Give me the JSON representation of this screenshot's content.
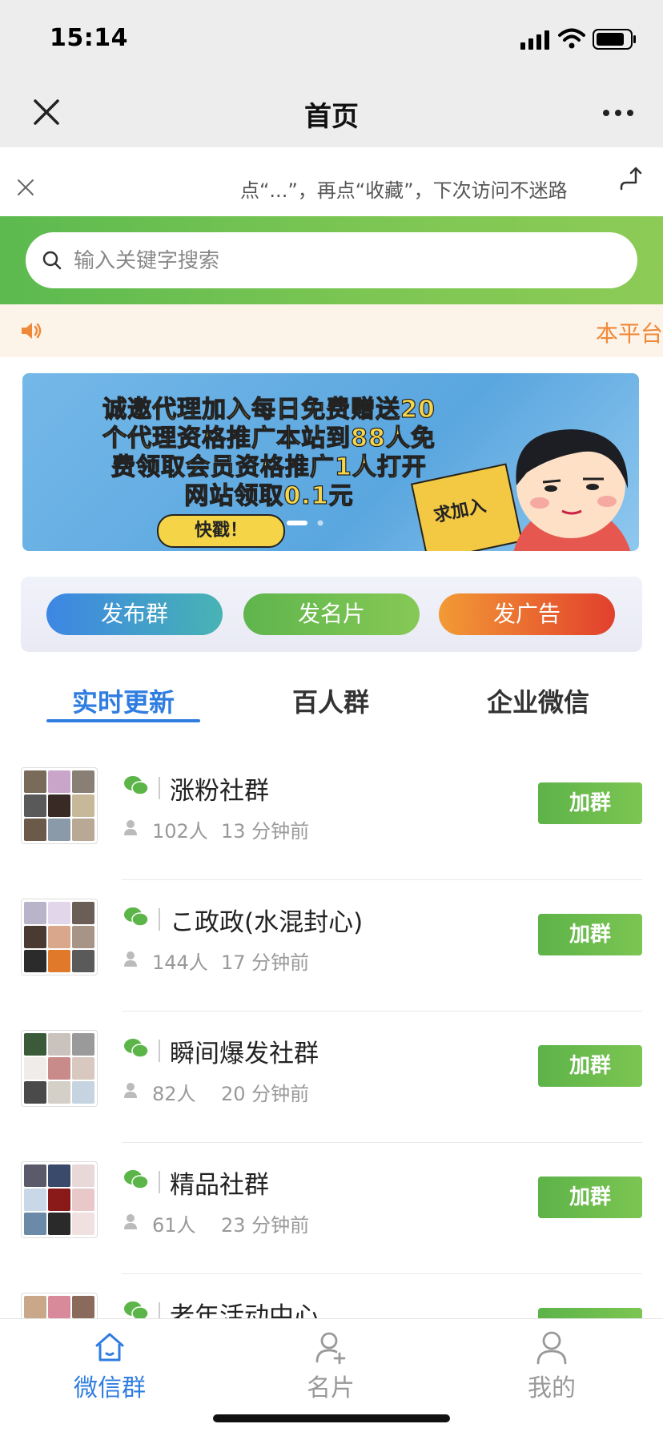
{
  "status_bar": {
    "time": "15:14"
  },
  "nav": {
    "title": "首页"
  },
  "tip": {
    "text": "点“...”，再点“收藏”，下次访问不迷路"
  },
  "search": {
    "placeholder": "输入关键字搜索"
  },
  "notice": {
    "text": "本平台"
  },
  "banner": {
    "line1": "诚邀代理加入每日免费赠送20",
    "line2": "个代理资格推广本站到88人免",
    "line3": "费领取会员资格推广1人打开",
    "line4": "网站领取0.1元",
    "button": "快戳！",
    "card": "求加入"
  },
  "actions": {
    "publish_group": "发布群",
    "publish_card": "发名片",
    "publish_ad": "发广告"
  },
  "tabs": [
    {
      "label": "实时更新",
      "active": true
    },
    {
      "label": "百人群",
      "active": false
    },
    {
      "label": "企业微信",
      "active": false
    }
  ],
  "groups": [
    {
      "name": "涨粉社群",
      "members": "102人",
      "time": "13 分钟前",
      "join": "加群"
    },
    {
      "name": "こ政政(水混封心)",
      "members": "144人",
      "time": "17 分钟前",
      "join": "加群"
    },
    {
      "name": "瞬间爆发社群",
      "members": "82人",
      "time": "20 分钟前",
      "join": "加群"
    },
    {
      "name": "精品社群",
      "members": "61人",
      "time": "23 分钟前",
      "join": "加群"
    },
    {
      "name": "老年活动中心",
      "members": "",
      "time": "",
      "join": ""
    }
  ],
  "bottom_tabs": [
    {
      "label": "微信群",
      "icon": "home-icon",
      "active": true
    },
    {
      "label": "名片",
      "icon": "add-user-icon",
      "active": false
    },
    {
      "label": "我的",
      "icon": "user-icon",
      "active": false
    }
  ],
  "colors": {
    "accent_blue": "#2f7de1",
    "green": "#6cbf4f",
    "orange": "#f0883a",
    "nav_bg": "#ededed"
  }
}
